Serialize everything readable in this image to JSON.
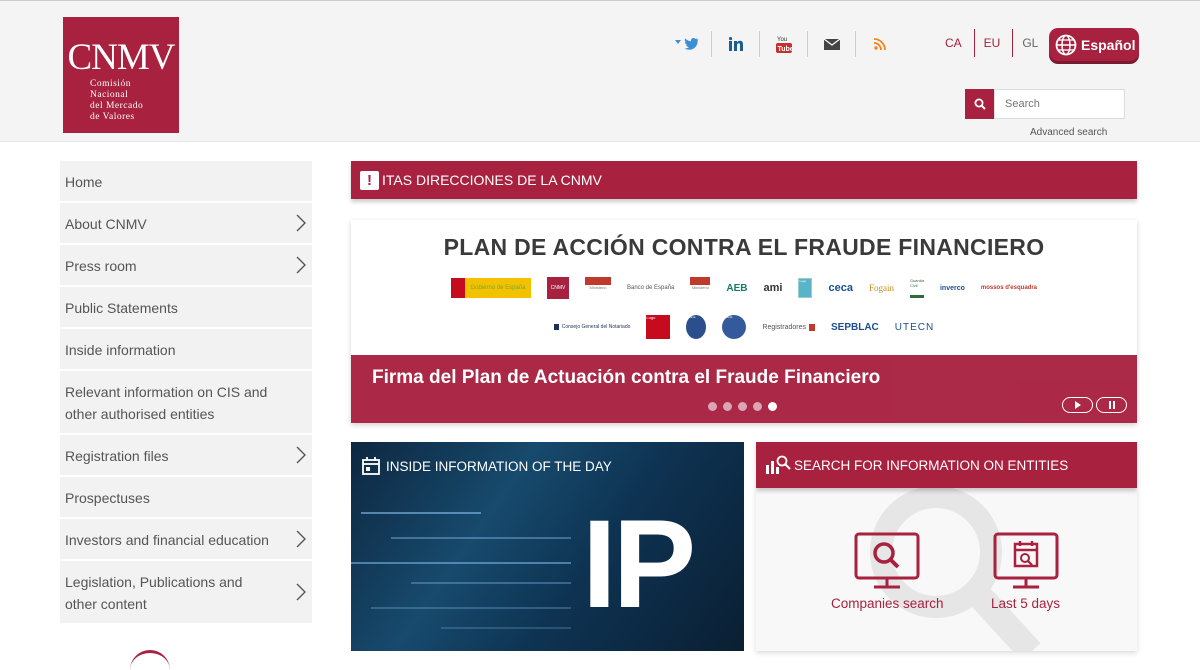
{
  "brand": {
    "logo_main": "CNMV",
    "logo_sub_1": "Comisión",
    "logo_sub_2": "Nacional",
    "logo_sub_3": "del Mercado",
    "logo_sub_4": "de Valores",
    "color": "#a8213f"
  },
  "header": {
    "socials": [
      "twitter-icon",
      "linkedin-icon",
      "youtube-icon",
      "mail-icon",
      "rss-icon"
    ],
    "languages": [
      "CA",
      "EU",
      "GL"
    ],
    "language_button": "Español",
    "search_placeholder": "Search",
    "advanced_search": "Advanced search"
  },
  "sidebar": {
    "items": [
      {
        "label": "Home",
        "chevron": false
      },
      {
        "label": "About CNMV",
        "chevron": true
      },
      {
        "label": "Press room",
        "chevron": true
      },
      {
        "label": "Public Statements",
        "chevron": false
      },
      {
        "label": "Inside information",
        "chevron": false
      },
      {
        "label": "Relevant information on CIS and other authorised entities",
        "chevron": false
      },
      {
        "label": "Registration files",
        "chevron": true
      },
      {
        "label": "Prospectuses",
        "chevron": false
      },
      {
        "label": "Investors and financial education",
        "chevron": true
      },
      {
        "label": "Legislation, Publications and other content",
        "chevron": true
      }
    ]
  },
  "alert_banner": {
    "text": "ITAS DIRECCIONES DE LA CNMV"
  },
  "carousel": {
    "title": "PLAN DE ACCIÓN CONTRA EL FRAUDE FINANCIERO",
    "partner_logos_row1": [
      "Gobierno de España",
      "CNMV",
      "Ministerio",
      "Banco de España",
      "Ministerio",
      "AEB",
      "ami",
      "Logo",
      "ceca",
      "Fogain",
      "Guardia Civil",
      "inverco",
      "mossos d'esquadra"
    ],
    "partner_logos_row2": [
      "Consejo General del Notariado",
      "Logo",
      "Policía",
      "Escudo",
      "Registradores",
      "SEPBLAC",
      "UTECN"
    ],
    "caption": "Firma del Plan de Actuación contra el Fraude Financiero",
    "slide_count": 5,
    "active_slide": 5
  },
  "cards": {
    "inside_info": {
      "title": "INSIDE INFORMATION OF THE DAY",
      "image_text": "IP"
    },
    "entity_search": {
      "title": "SEARCH FOR INFORMATION ON ENTITIES",
      "tiles": [
        "Companies search",
        "Last 5 days"
      ]
    }
  }
}
